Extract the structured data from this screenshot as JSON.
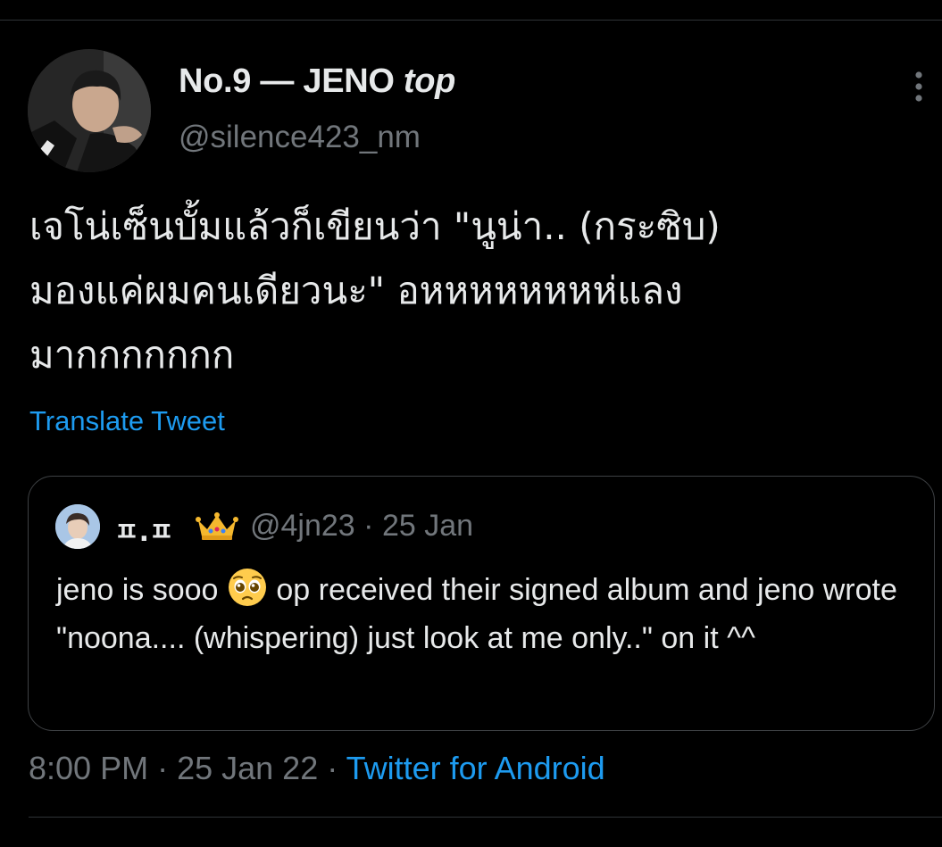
{
  "author": {
    "name_prefix": "No.9 — JENO ",
    "name_suffix": "top",
    "handle": "@silence423_nm",
    "avatar_icon": "profile-photo"
  },
  "more_icon": "more-vertical-icon",
  "tweet": {
    "text": "เจโน่เซ็นบั้มแล้วก็เขียนว่า \"นูน่า.. (กระซิบ)\nมองแค่ผมคนเดียวนะ\" อหหหหหหหห่แลง\nมากกกกกกก",
    "translate_label": "Translate Tweet"
  },
  "quoted": {
    "name": "ㅍ.ㅍ",
    "badge_icon": "crown-icon",
    "handle": "@4jn23",
    "separator": "·",
    "date": "25 Jan",
    "text_before_emoji": "jeno is sooo ",
    "emoji": "pleading-face-emoji",
    "text_after_emoji": " op received their signed album and jeno wrote \"noona.... (whispering) just look at me only..\" on it ^^"
  },
  "footer": {
    "time": "8:00 PM",
    "separator": " · ",
    "date": "25 Jan 22",
    "source": "Twitter for Android"
  },
  "colors": {
    "background": "#000000",
    "text": "#e7e9ea",
    "muted": "#71767b",
    "link": "#1d9bf0",
    "border": "#3e4144"
  }
}
